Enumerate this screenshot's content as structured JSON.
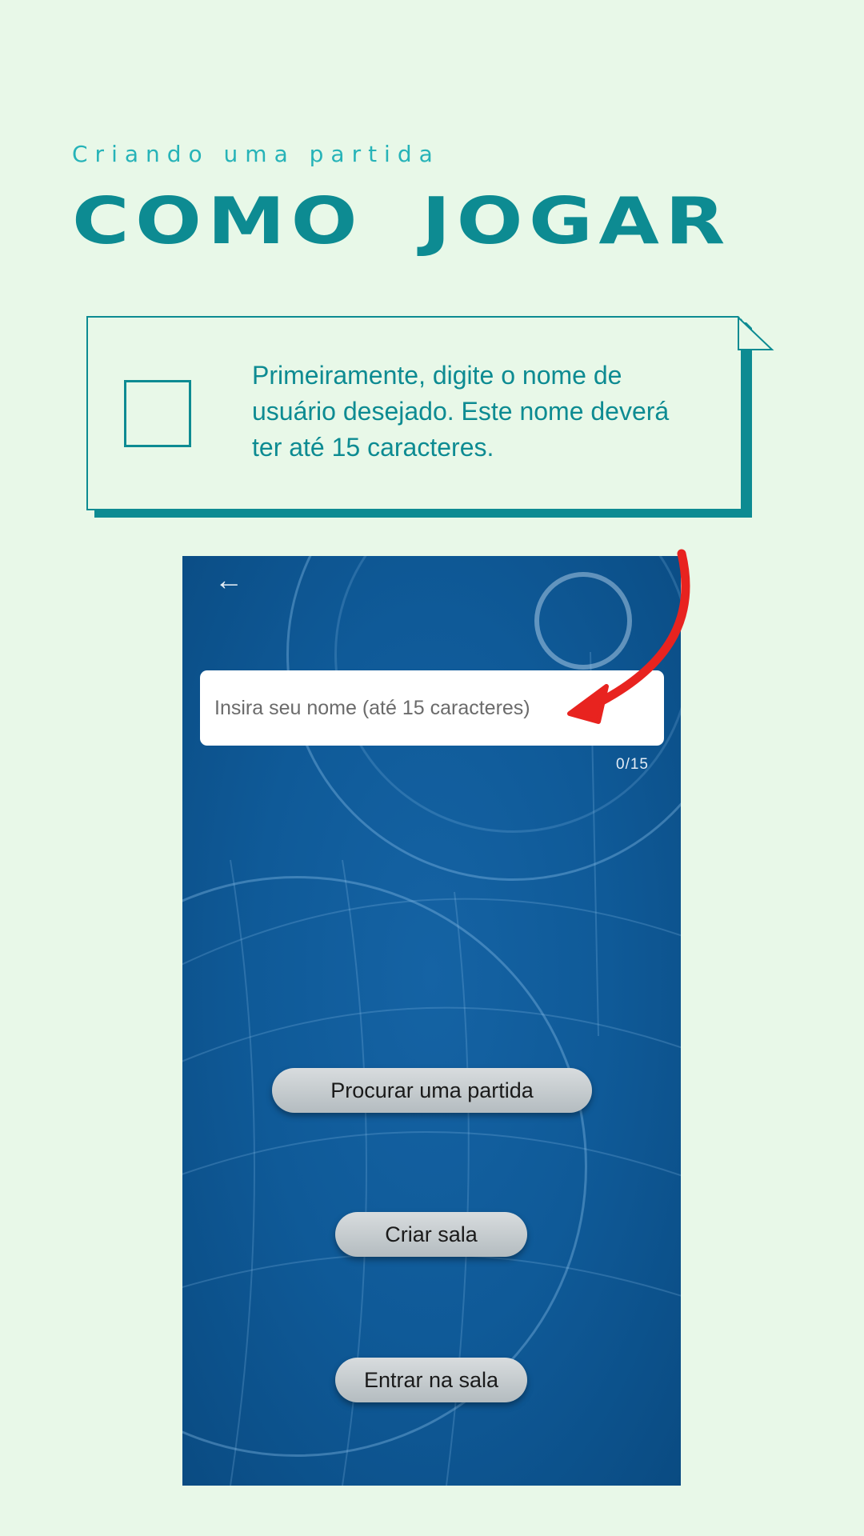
{
  "header": {
    "subtitle": "Criando uma partida",
    "title": "COMO JOGAR"
  },
  "note": {
    "text": "Primeiramente, digite o nome de usuário desejado. Este nome deverá ter até 15 caracteres."
  },
  "app": {
    "name_placeholder": "Insira seu nome (até 15 caracteres)",
    "counter": "0/15",
    "buttons": {
      "find_match": "Procurar uma partida",
      "create_room": "Criar sala",
      "join_room": "Entrar na sala"
    }
  },
  "colors": {
    "background": "#e8f8e8",
    "accent": "#0d8b92",
    "subtitle": "#26b3b8",
    "app_background": "#0f5a98",
    "annotation_arrow": "#e8231f"
  },
  "icons": {
    "back": "arrow-left-icon",
    "annotation": "red-curved-arrow-icon",
    "checkbox": "checkbox-icon"
  }
}
